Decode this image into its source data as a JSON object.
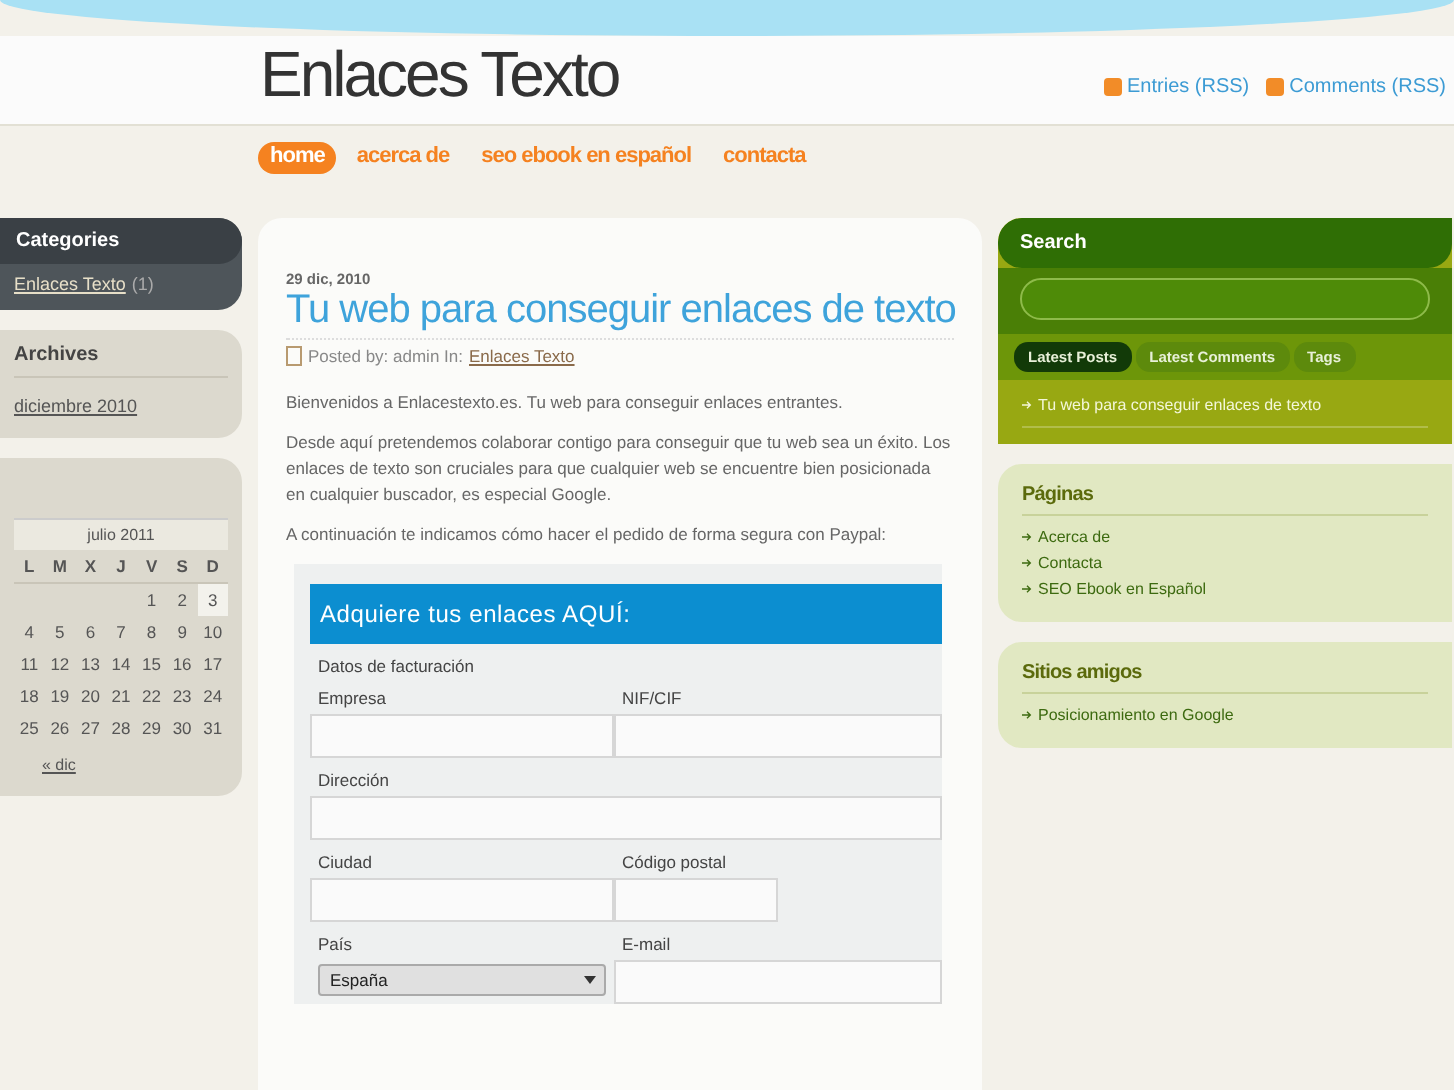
{
  "header": {
    "title": "Enlaces Texto",
    "feeds": [
      "Entries (RSS)",
      "Comments (RSS)"
    ]
  },
  "nav": [
    {
      "label": "home",
      "selected": true
    },
    {
      "label": "acerca de",
      "selected": false
    },
    {
      "label": "seo ebook en español",
      "selected": false
    },
    {
      "label": "contacta",
      "selected": false
    }
  ],
  "left": {
    "categories": {
      "title": "Categories",
      "items": [
        {
          "label": "Enlaces Texto",
          "count": "(1)"
        }
      ]
    },
    "archives": {
      "title": "Archives",
      "items": [
        "diciembre 2010"
      ]
    },
    "calendar": {
      "caption": "julio 2011",
      "weekdays": [
        "L",
        "M",
        "X",
        "J",
        "V",
        "S",
        "D"
      ],
      "weeks": [
        [
          {
            "day": "1",
            "today": false
          },
          {
            "day": "2",
            "today": false
          },
          {
            "day": "3",
            "today": true
          }
        ],
        [
          {
            "day": "4",
            "today": false
          },
          {
            "day": "5",
            "today": false
          },
          {
            "day": "6",
            "today": false
          },
          {
            "day": "7",
            "today": false
          },
          {
            "day": "8",
            "today": false
          },
          {
            "day": "9",
            "today": false
          },
          {
            "day": "10",
            "today": false
          }
        ],
        [
          {
            "day": "11",
            "today": false
          },
          {
            "day": "12",
            "today": false
          },
          {
            "day": "13",
            "today": false
          },
          {
            "day": "14",
            "today": false
          },
          {
            "day": "15",
            "today": false
          },
          {
            "day": "16",
            "today": false
          },
          {
            "day": "17",
            "today": false
          }
        ],
        [
          {
            "day": "18",
            "today": false
          },
          {
            "day": "19",
            "today": false
          },
          {
            "day": "20",
            "today": false
          },
          {
            "day": "21",
            "today": false
          },
          {
            "day": "22",
            "today": false
          },
          {
            "day": "23",
            "today": false
          },
          {
            "day": "24",
            "today": false
          }
        ],
        [
          {
            "day": "25",
            "today": false
          },
          {
            "day": "26",
            "today": false
          },
          {
            "day": "27",
            "today": false
          },
          {
            "day": "28",
            "today": false
          },
          {
            "day": "29",
            "today": false
          },
          {
            "day": "30",
            "today": false
          },
          {
            "day": "31",
            "today": false
          }
        ]
      ],
      "prev": "« dic"
    }
  },
  "post": {
    "date": "29 dic, 2010",
    "title": "Tu web para conseguir enlaces de texto",
    "meta": "Posted by: admin In:",
    "category": "Enlaces Texto",
    "paragraphs": [
      "Bienvenidos a Enlacestexto.es. Tu web para conseguir enlaces entrantes.",
      "Desde aquí pretendemos colaborar contigo para conseguir que tu web sea un éxito. Los enlaces de texto son cruciales para que cualquier web se encuentre bien posicionada en cualquier buscador, es especial Google.",
      "A continuación te indicamos cómo hacer el pedido de forma segura con Paypal:"
    ],
    "form": {
      "heading": "Adquiere tus enlaces AQUÍ:",
      "section": "Datos de facturación",
      "fields": [
        {
          "label": "Empresa",
          "kind": "half"
        },
        {
          "label": "NIF/CIF",
          "kind": "half"
        },
        {
          "label": "Dirección",
          "kind": "full"
        },
        {
          "label": "Ciudad",
          "kind": "half"
        },
        {
          "label": "Código postal",
          "kind": "short"
        },
        {
          "label": "País",
          "kind": "select",
          "value": "España"
        },
        {
          "label": "E-mail",
          "kind": "half"
        }
      ]
    }
  },
  "right": {
    "search": {
      "title": "Search",
      "tabs": [
        {
          "label": "Latest Posts",
          "selected": true
        },
        {
          "label": "Latest Comments",
          "selected": false
        },
        {
          "label": "Tags",
          "selected": false
        }
      ],
      "items": [
        "Tu web para conseguir enlaces de texto"
      ]
    },
    "widgets": [
      {
        "title": "Páginas",
        "items": [
          "Acerca de",
          "Contacta",
          "SEO Ebook en Español"
        ]
      },
      {
        "title": "Sitios amigos",
        "items": [
          "Posicionamiento en Google"
        ]
      }
    ]
  }
}
